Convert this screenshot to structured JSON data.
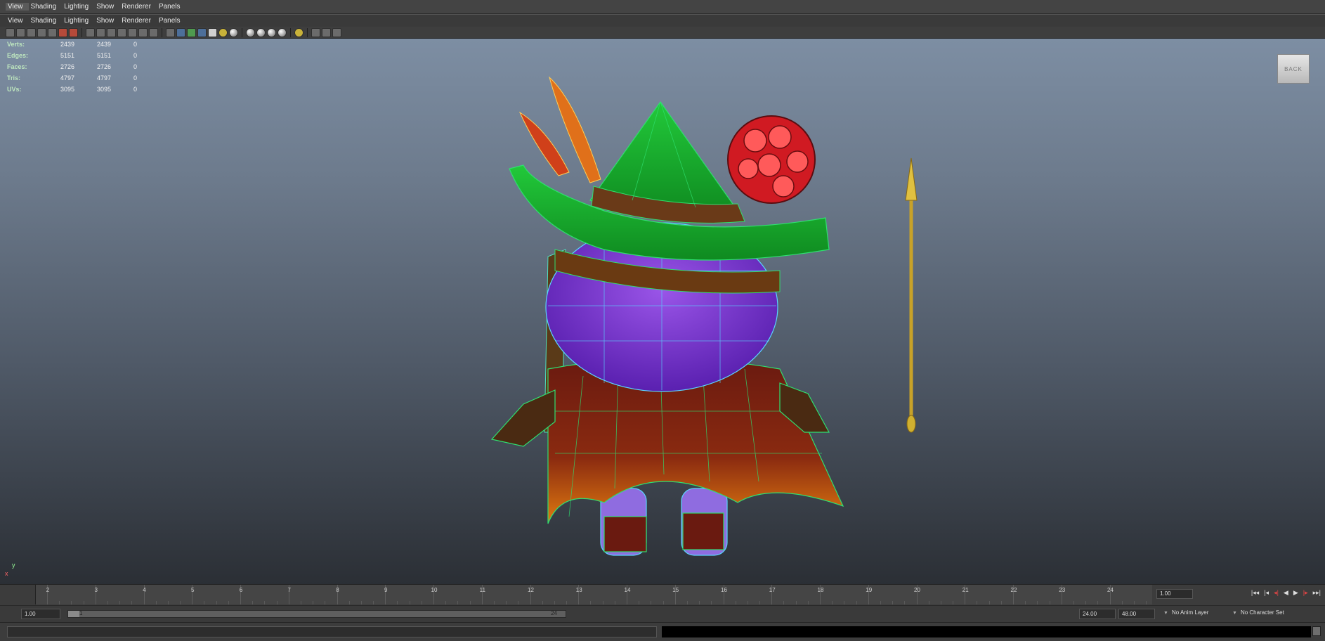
{
  "menubar_top": {
    "items": [
      "View",
      "Shading",
      "Lighting",
      "Show",
      "Renderer",
      "Panels"
    ]
  },
  "menubar_panel": {
    "items": [
      "View",
      "Shading",
      "Lighting",
      "Show",
      "Renderer",
      "Panels"
    ]
  },
  "hud": {
    "rows": [
      {
        "label": "Verts:",
        "v1": "2439",
        "v2": "2439",
        "v3": "0"
      },
      {
        "label": "Edges:",
        "v1": "5151",
        "v2": "5151",
        "v3": "0"
      },
      {
        "label": "Faces:",
        "v1": "2726",
        "v2": "2726",
        "v3": "0"
      },
      {
        "label": "Tris:",
        "v1": "4797",
        "v2": "4797",
        "v3": "0"
      },
      {
        "label": "UVs:",
        "v1": "3095",
        "v2": "3095",
        "v3": "0"
      }
    ]
  },
  "viewcube": {
    "label": "BACK"
  },
  "axis": {
    "y": "y",
    "x": "x"
  },
  "timeline": {
    "ticks": [
      "2",
      "3",
      "4",
      "5",
      "6",
      "7",
      "8",
      "9",
      "10",
      "11",
      "12",
      "13",
      "14",
      "15",
      "16",
      "17",
      "18",
      "19",
      "20",
      "21",
      "22",
      "23",
      "24"
    ],
    "current_frame": "1.00",
    "buttons": [
      "|◂◂",
      "|◂",
      "◂|",
      "◀",
      "▶",
      "|▸",
      "▸▸|"
    ]
  },
  "range": {
    "start_field": "1.00",
    "slider_start": "1",
    "slider_end": "24",
    "anim_end": "24.00",
    "anim_end2": "48.00",
    "anim_layer": "No Anim Layer",
    "character_set": "No Character Set"
  }
}
